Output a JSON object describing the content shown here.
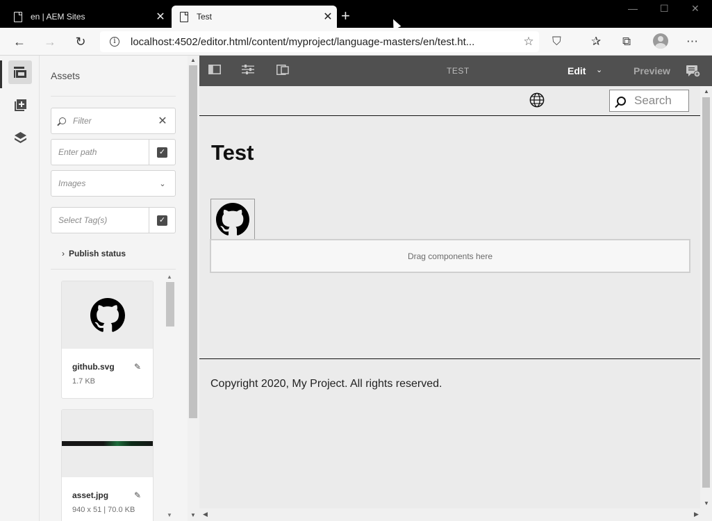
{
  "browser": {
    "tabs": [
      {
        "title": "en | AEM Sites",
        "active": false
      },
      {
        "title": "Test",
        "active": true
      }
    ],
    "url": "localhost:4502/editor.html/content/myproject/language-masters/en/test.ht..."
  },
  "panel": {
    "title": "Assets",
    "filter_placeholder": "Filter",
    "path_placeholder": "Enter path",
    "type_selected": "Images",
    "tags_placeholder": "Select Tag(s)",
    "publish_status": "Publish status",
    "assets": [
      {
        "name": "github.svg",
        "meta": "1.7 KB"
      },
      {
        "name": "asset.jpg",
        "meta": "940 x 51 | 70.0 KB"
      }
    ]
  },
  "editor": {
    "page_name": "TEST",
    "mode": "Edit",
    "preview": "Preview"
  },
  "page": {
    "search_placeholder": "Search",
    "title": "Test",
    "drop_zone": "Drag components here",
    "footer": "Copyright 2020, My Project. All rights reserved."
  },
  "colors": {
    "editor_toolbar": "#505050",
    "rail_bg": "#f4f4f4",
    "canvas_bg": "#ebebeb"
  }
}
